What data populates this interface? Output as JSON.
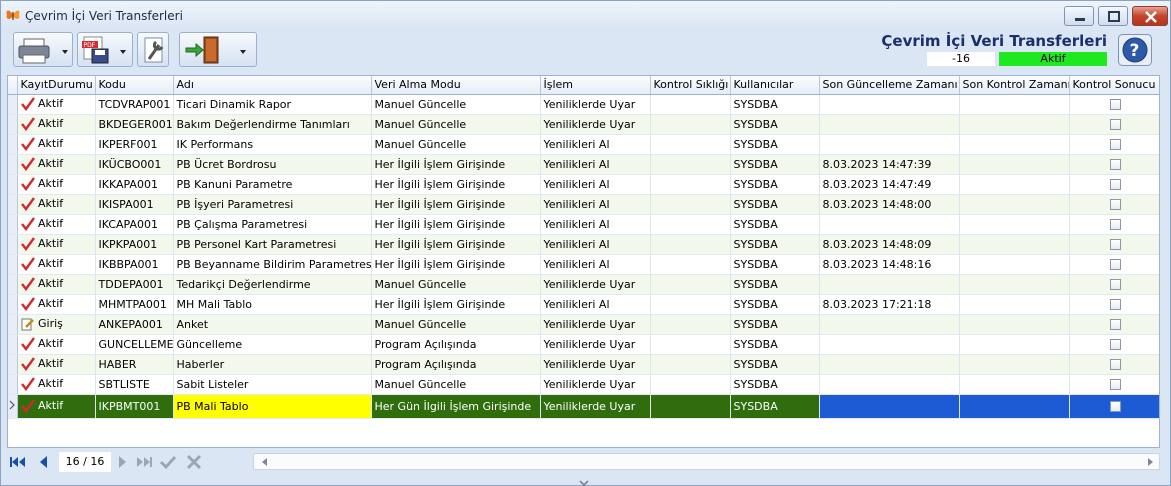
{
  "window": {
    "title": "Çevrim İçi Veri Transferleri"
  },
  "header": {
    "title": "Çevrim İçi Veri Transferleri",
    "number": "-16",
    "status": "Aktif",
    "status_color": "#1ee81e"
  },
  "grid": {
    "columns": [
      "KayıtDurumu",
      "Kodu",
      "Adı",
      "Veri Alma Modu",
      "İşlem",
      "Kontrol Sıklığı",
      "Kullanıcılar",
      "Son Güncelleme Zamanı",
      "Son Kontrol Zamanı",
      "Kontrol Sonucu"
    ],
    "rows": [
      {
        "status": "Aktif",
        "icon": "check-icon",
        "kodu": "TCDVRAP001",
        "adi": "Ticari Dinamik Rapor",
        "mod": "Manuel Güncelle",
        "islem": "Yeniliklerde Uyar",
        "siklik": "",
        "kullanici": "SYSDBA",
        "guncelleme": "",
        "kontrol": ""
      },
      {
        "status": "Aktif",
        "icon": "check-icon",
        "kodu": "BKDEGER001",
        "adi": "Bakım Değerlendirme Tanımları",
        "mod": "Manuel Güncelle",
        "islem": "Yeniliklerde Uyar",
        "siklik": "",
        "kullanici": "SYSDBA",
        "guncelleme": "",
        "kontrol": ""
      },
      {
        "status": "Aktif",
        "icon": "check-icon",
        "kodu": "IKPERF001",
        "adi": "IK Performans",
        "mod": "Manuel Güncelle",
        "islem": "Yenilikleri Al",
        "siklik": "",
        "kullanici": "SYSDBA",
        "guncelleme": "",
        "kontrol": ""
      },
      {
        "status": "Aktif",
        "icon": "check-icon",
        "kodu": "IKÜCBO001",
        "adi": "PB Ücret Bordrosu",
        "mod": "Her İlgili İşlem Girişinde",
        "islem": "Yenilikleri Al",
        "siklik": "",
        "kullanici": "SYSDBA",
        "guncelleme": "8.03.2023 14:47:39",
        "kontrol": ""
      },
      {
        "status": "Aktif",
        "icon": "check-icon",
        "kodu": "IKKAPA001",
        "adi": "PB Kanuni Parametre",
        "mod": "Her İlgili İşlem Girişinde",
        "islem": "Yenilikleri Al",
        "siklik": "",
        "kullanici": "SYSDBA",
        "guncelleme": "8.03.2023 14:47:49",
        "kontrol": ""
      },
      {
        "status": "Aktif",
        "icon": "check-icon",
        "kodu": "IKISPA001",
        "adi": "PB İşyeri Parametresi",
        "mod": "Her İlgili İşlem Girişinde",
        "islem": "Yenilikleri Al",
        "siklik": "",
        "kullanici": "SYSDBA",
        "guncelleme": "8.03.2023 14:48:00",
        "kontrol": ""
      },
      {
        "status": "Aktif",
        "icon": "check-icon",
        "kodu": "IKCAPA001",
        "adi": "PB Çalışma Parametresi",
        "mod": "Her İlgili İşlem Girişinde",
        "islem": "Yenilikleri Al",
        "siklik": "",
        "kullanici": "SYSDBA",
        "guncelleme": "",
        "kontrol": ""
      },
      {
        "status": "Aktif",
        "icon": "check-icon",
        "kodu": "IKPKPA001",
        "adi": "PB Personel Kart Parametresi",
        "mod": "Her İlgili İşlem Girişinde",
        "islem": "Yenilikleri Al",
        "siklik": "",
        "kullanici": "SYSDBA",
        "guncelleme": "8.03.2023 14:48:09",
        "kontrol": ""
      },
      {
        "status": "Aktif",
        "icon": "check-icon",
        "kodu": "IKBBPA001",
        "adi": "PB Beyanname Bildirim Parametresi",
        "mod": "Her İlgili İşlem Girişinde",
        "islem": "Yenilikleri Al",
        "siklik": "",
        "kullanici": "SYSDBA",
        "guncelleme": "8.03.2023 14:48:16",
        "kontrol": ""
      },
      {
        "status": "Aktif",
        "icon": "check-icon",
        "kodu": "TDDEPA001",
        "adi": "Tedarikçi Değerlendirme",
        "mod": "Manuel Güncelle",
        "islem": "Yeniliklerde Uyar",
        "siklik": "",
        "kullanici": "SYSDBA",
        "guncelleme": "",
        "kontrol": ""
      },
      {
        "status": "Aktif",
        "icon": "check-icon",
        "kodu": "MHMTPA001",
        "adi": "MH Mali Tablo",
        "mod": "Her İlgili İşlem Girişinde",
        "islem": "Yenilikleri Al",
        "siklik": "",
        "kullanici": "SYSDBA",
        "guncelleme": "8.03.2023 17:21:18",
        "kontrol": ""
      },
      {
        "status": "Giriş",
        "icon": "edit-icon",
        "kodu": "ANKEPA001",
        "adi": "Anket",
        "mod": "Manuel Güncelle",
        "islem": "Yeniliklerde Uyar",
        "siklik": "",
        "kullanici": "SYSDBA",
        "guncelleme": "",
        "kontrol": ""
      },
      {
        "status": "Aktif",
        "icon": "check-icon",
        "kodu": "GUNCELLEME",
        "adi": "Güncelleme",
        "mod": "Program Açılışında",
        "islem": "Yeniliklerde Uyar",
        "siklik": "",
        "kullanici": "SYSDBA",
        "guncelleme": "",
        "kontrol": ""
      },
      {
        "status": "Aktif",
        "icon": "check-icon",
        "kodu": "HABER",
        "adi": "Haberler",
        "mod": "Program Açılışında",
        "islem": "Yeniliklerde Uyar",
        "siklik": "",
        "kullanici": "SYSDBA",
        "guncelleme": "",
        "kontrol": ""
      },
      {
        "status": "Aktif",
        "icon": "check-icon",
        "kodu": "SBTLISTE",
        "adi": "Sabit Listeler",
        "mod": "Manuel Güncelle",
        "islem": "Yeniliklerde Uyar",
        "siklik": "",
        "kullanici": "SYSDBA",
        "guncelleme": "",
        "kontrol": ""
      },
      {
        "status": "Aktif",
        "icon": "check-icon",
        "kodu": "IKPBMT001",
        "adi": "PB Mali Tablo",
        "mod": "Her Gün İlgili İşlem Girişinde",
        "islem": "Yeniliklerde Uyar",
        "siklik": "",
        "kullanici": "SYSDBA",
        "guncelleme": "",
        "kontrol": "",
        "selected": true
      }
    ]
  },
  "navigator": {
    "record_count": "16 / 16"
  },
  "icons": {
    "check_color": "#d22a2a",
    "accent": "#1a2f6b"
  }
}
